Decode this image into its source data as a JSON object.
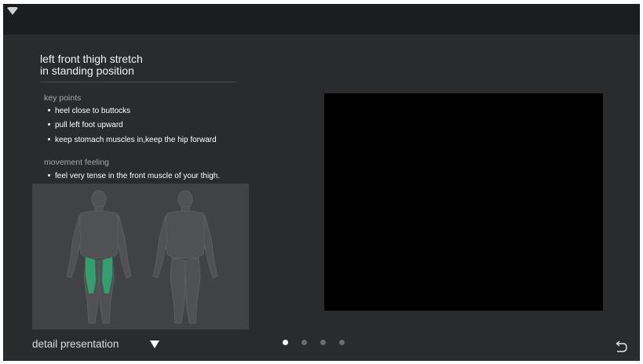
{
  "title_lines": [
    "left front thigh stretch",
    "in standing position"
  ],
  "key_points": {
    "label": "key points",
    "items": [
      "heel close to buttocks",
      "pull left foot upward",
      "keep stomach muscles in,keep the hip forward"
    ]
  },
  "movement_feeling": {
    "label": "movement feeling",
    "items": [
      "feel very tense in the front muscle of your thigh."
    ]
  },
  "detail": {
    "label": "detail presentation"
  },
  "pager": {
    "total": 4,
    "active": 0
  },
  "colors": {
    "background": "#2a2b2d",
    "status_bar": "#1c1d1f",
    "highlight_muscle": "#2fa06e",
    "video_area": "#000000",
    "text": "#ffffff"
  },
  "icons": {
    "status": "wifi-icon",
    "detail_toggle": "triangle-down-icon",
    "back": "return-icon"
  }
}
